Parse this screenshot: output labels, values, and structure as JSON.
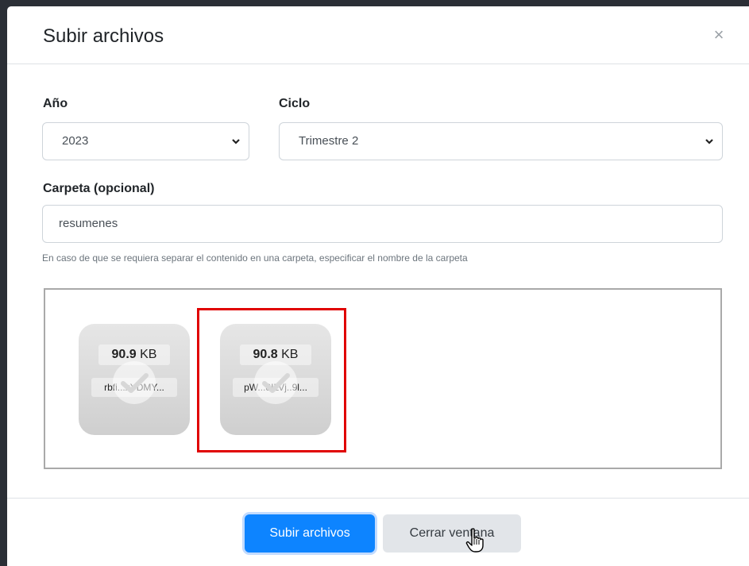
{
  "modal": {
    "title": "Subir archivos",
    "close_label": "×"
  },
  "form": {
    "year": {
      "label": "Año",
      "value": "2023"
    },
    "cycle": {
      "label": "Ciclo",
      "value": "Trimestre 2"
    },
    "folder": {
      "label": "Carpeta (opcional)",
      "value": "resumenes",
      "help": "En caso de que se requiera separar el contenido en una carpeta, especificar el nombre de la carpeta"
    }
  },
  "files": [
    {
      "size_num": "90.9",
      "size_unit": "KB",
      "name": "rbfi...xYDMY..."
    },
    {
      "size_num": "90.8",
      "size_unit": "KB",
      "name": "pW...8ILVj..9l..."
    }
  ],
  "footer": {
    "submit_label": "Subir archivos",
    "close_label": "Cerrar ventana"
  },
  "colors": {
    "primary": "#0d84ff",
    "highlight": "#e00000"
  }
}
